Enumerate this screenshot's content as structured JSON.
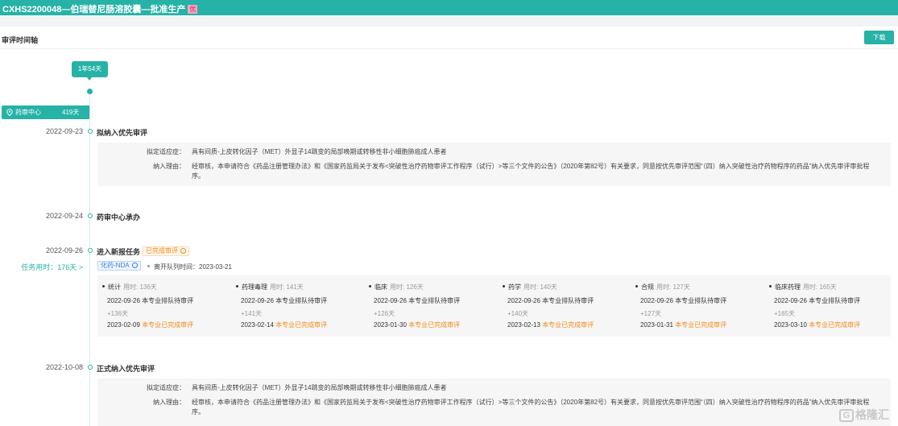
{
  "header": {
    "title": "CXHS2200048—伯瑞替尼肠溶胶囊—批准生产",
    "badge": "优"
  },
  "section": {
    "title": "审评时间轴",
    "download_label": "下载"
  },
  "timeline": {
    "total_duration": "1年54天",
    "center": {
      "label": "药审中心",
      "days": "419天"
    },
    "events": [
      {
        "date": "2022-09-23",
        "title": "拟纳入优先审评",
        "info": [
          {
            "key": "拟定适应症：",
            "value": "具有间质-上皮转化因子（MET）外显子14跳变的局部晚期或转移性非小细胞肺癌成人患者"
          },
          {
            "key": "纳入理由：",
            "value": "经审核，本申请符合《药品注册管理办法》和《国家药监局关于发布<突破性治疗药物审评工作程序（试行）>等三个文件的公告》（2020年第82号）有关要求，同意按优先审评范围“（四）纳入突破性治疗药物程序的药品”纳入优先审评审批程序。"
          }
        ]
      },
      {
        "date": "2022-09-24",
        "title": "药审中心承办"
      },
      {
        "date": "2022-09-26",
        "title": "进入新报任务",
        "status": "已完成审评",
        "task_time": "任务用时：176天 >",
        "tag": "化药-NDA",
        "leave_time": "离开队列时间：2023-03-21",
        "reviews": [
          {
            "name": "统计",
            "used": "用时: 136天",
            "line1": "2022-09-26  本专业排队待审评",
            "delta": "+136天",
            "date2": "2023-02-09",
            "status2": "本专业已完成审评"
          },
          {
            "name": "药理毒理",
            "used": "用时: 141天",
            "line1": "2022-09-26  本专业排队待审评",
            "delta": "+141天",
            "date2": "2023-02-14",
            "status2": "本专业已完成审评"
          },
          {
            "name": "临床",
            "used": "用时: 126天",
            "line1": "2022-09-26  本专业排队待审评",
            "delta": "+126天",
            "date2": "2023-01-30",
            "status2": "本专业已完成审评"
          },
          {
            "name": "药学",
            "used": "用时: 140天",
            "line1": "2022-09-26  本专业排队待审评",
            "delta": "+140天",
            "date2": "2023-02-13",
            "status2": "本专业已完成审评"
          },
          {
            "name": "合规",
            "used": "用时: 127天",
            "line1": "2022-09-26  本专业排队待审评",
            "delta": "+127天",
            "date2": "2023-01-31",
            "status2": "本专业已完成审评"
          },
          {
            "name": "临床药理",
            "used": "用时: 165天",
            "line1": "2022-09-26  本专业排队待审评",
            "delta": "+165天",
            "date2": "2023-03-10",
            "status2": "本专业已完成审评"
          }
        ]
      },
      {
        "date": "2022-10-08",
        "title": "正式纳入优先审评",
        "info": [
          {
            "key": "拟定适应症：",
            "value": "具有间质-上皮转化因子（MET）外显子14跳变的局部晚期或转移性非小细胞肺癌成人患者"
          },
          {
            "key": "纳入理由：",
            "value": "经审核，本申请符合《药品注册管理办法》和《国家药监局关于发布<突破性治疗药物审评工作程序（试行）>等三个文件的公告》（2020年第82号）有关要求，同意按优先审评范围“（四）纳入突破性治疗药物程序的药品”纳入优先审评审批程序。"
          }
        ]
      }
    ]
  },
  "watermark": {
    "glyph": "G",
    "text": "格隆汇"
  },
  "colors": {
    "accent": "#26b2a6",
    "status_orange": "#f08c1a",
    "tag_blue": "#3b7ddb"
  }
}
